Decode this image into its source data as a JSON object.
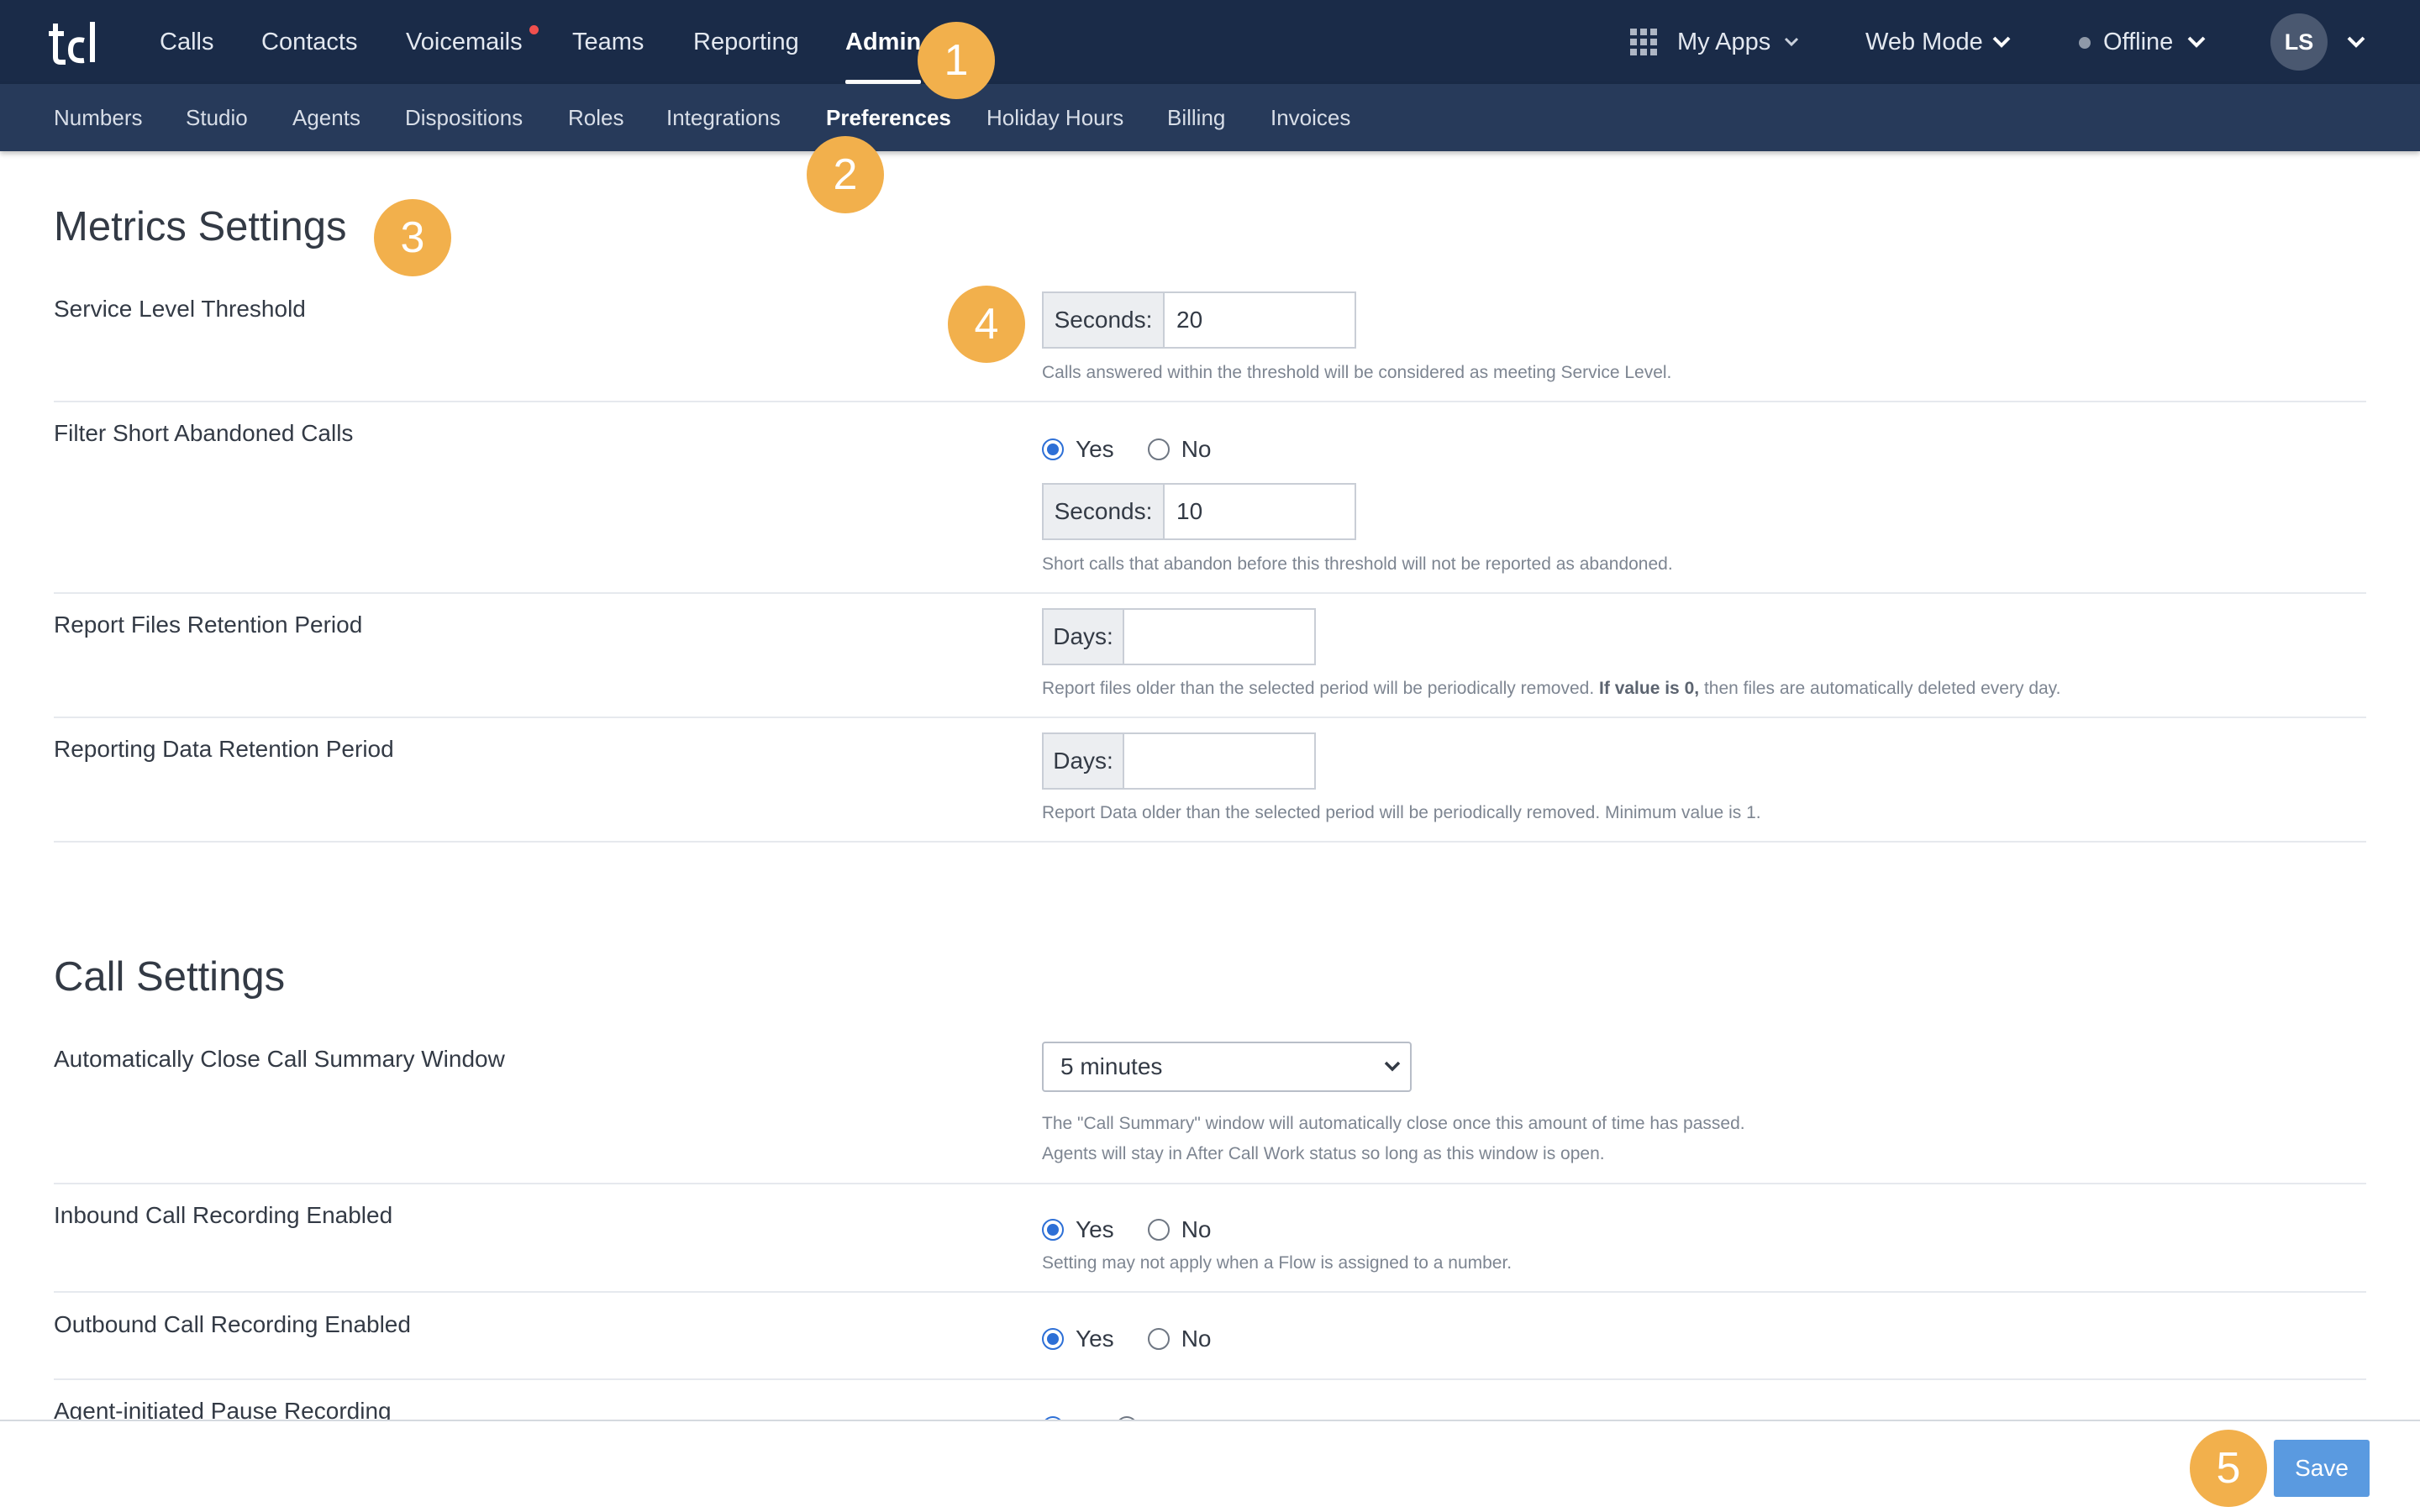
{
  "topnav": {
    "logo": "tcl",
    "items": [
      {
        "label": "Calls"
      },
      {
        "label": "Contacts"
      },
      {
        "label": "Voicemails"
      },
      {
        "label": "Teams"
      },
      {
        "label": "Reporting"
      },
      {
        "label": "Admin",
        "active": true
      }
    ],
    "my_apps": "My Apps",
    "web_mode": "Web Mode",
    "status": "Offline",
    "avatar_initials": "LS"
  },
  "subnav": {
    "items": [
      {
        "label": "Numbers"
      },
      {
        "label": "Studio"
      },
      {
        "label": "Agents"
      },
      {
        "label": "Dispositions"
      },
      {
        "label": "Roles"
      },
      {
        "label": "Integrations"
      },
      {
        "label": "Preferences",
        "active": true
      },
      {
        "label": "Holiday Hours"
      },
      {
        "label": "Billing"
      },
      {
        "label": "Invoices"
      }
    ]
  },
  "badges": [
    "1",
    "2",
    "3",
    "4",
    "5"
  ],
  "metrics": {
    "title": "Metrics Settings",
    "service_level": {
      "label": "Service Level Threshold",
      "addon": "Seconds:",
      "value": "20",
      "help": "Calls answered within the threshold will be considered as meeting Service Level."
    },
    "filter_short": {
      "label": "Filter Short Abandoned Calls",
      "yes": "Yes",
      "no": "No",
      "selected": "Yes",
      "addon": "Seconds:",
      "value": "10",
      "help": "Short calls that abandon before this threshold will not be reported as abandoned."
    },
    "report_files": {
      "label": "Report Files Retention Period",
      "addon": "Days:",
      "value": "",
      "help_pre": "Report files older than the selected period will be periodically removed.",
      "help_bold": "If value is 0,",
      "help_post": "then files are automatically deleted every day."
    },
    "reporting_data": {
      "label": "Reporting Data Retention Period",
      "addon": "Days:",
      "value": "",
      "help": "Report Data older than the selected period will be periodically removed. Minimum value is 1."
    }
  },
  "call": {
    "title": "Call Settings",
    "auto_close": {
      "label": "Automatically Close Call Summary Window",
      "selected": "5 minutes",
      "help1": "The \"Call Summary\" window will automatically close once this amount of time has passed.",
      "help2": "Agents will stay in After Call Work status so long as this window is open."
    },
    "inbound": {
      "label": "Inbound Call Recording Enabled",
      "yes": "Yes",
      "no": "No",
      "selected": "Yes",
      "help": "Setting may not apply when a Flow is assigned to a number."
    },
    "outbound": {
      "label": "Outbound Call Recording Enabled",
      "yes": "Yes",
      "no": "No",
      "selected": "Yes"
    },
    "agent_pause": {
      "label": "Agent-initiated Pause Recording"
    }
  },
  "footer": {
    "save_label": "Save"
  },
  "colors": {
    "topbar": "#1a2b48",
    "subbar": "#273a5a",
    "badge": "#f2b04c",
    "accent": "#2d6fd6",
    "save": "#5a9ae0"
  }
}
